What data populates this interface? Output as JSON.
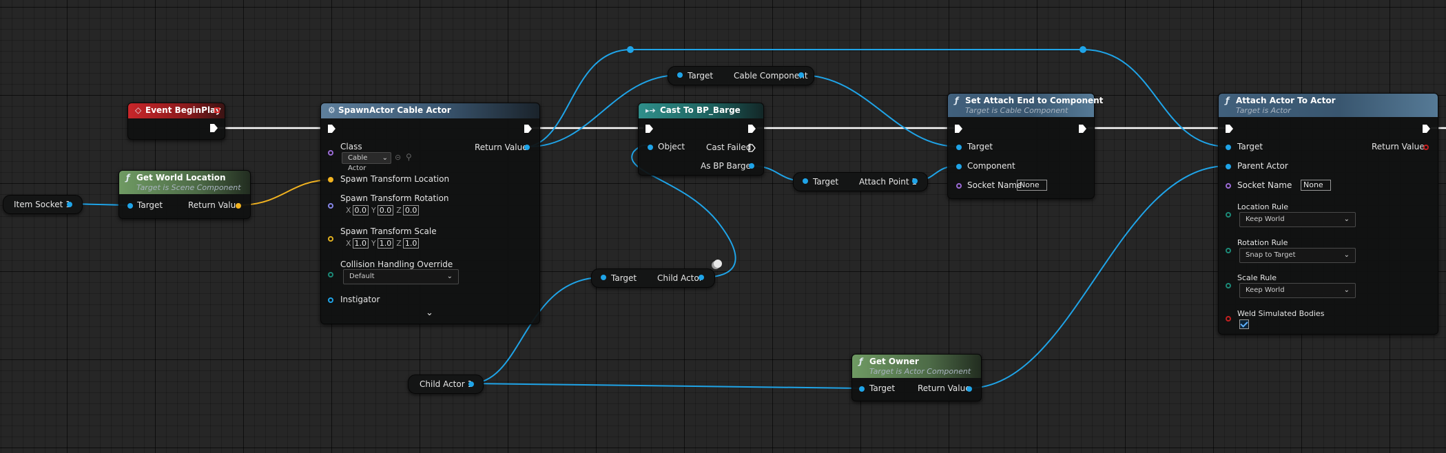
{
  "colors": {
    "object_wire": "#1fa4e8",
    "exec_wire": "#ffffff",
    "vector_wire": "#f2b320",
    "graph_bg": "#262626"
  },
  "nodes": {
    "event_begin_play": {
      "title": "Event BeginPlay",
      "icon": "event-diamond-icon"
    },
    "get_world_location": {
      "title": "Get World Location",
      "subtitle": "Target is Scene Component",
      "target": "Target",
      "return_value": "Return Value"
    },
    "spawn_actor": {
      "title": "SpawnActor Cable Actor",
      "class_label": "Class",
      "class_value": "Cable Actor",
      "return_value": "Return Value",
      "spawn_location": "Spawn Transform Location",
      "spawn_rotation": "Spawn Transform Rotation",
      "rotation": {
        "x": "0.0",
        "y": "0.0",
        "z": "0.0"
      },
      "spawn_scale": "Spawn Transform Scale",
      "scale": {
        "x": "1.0",
        "y": "1.0",
        "z": "1.0"
      },
      "axis_x": "X",
      "axis_y": "Y",
      "axis_z": "Z",
      "collision_label": "Collision Handling Override",
      "collision_value": "Default",
      "instigator": "Instigator"
    },
    "cast_to_barge": {
      "title": "Cast To BP_Barge",
      "object": "Object",
      "cast_failed": "Cast Failed",
      "as_bp_barge": "As BP Barge"
    },
    "set_attach_end": {
      "title": "Set Attach End to Component",
      "subtitle": "Target is Cable Component",
      "target": "Target",
      "component": "Component",
      "socket_name": "Socket Name",
      "socket_value": "None"
    },
    "attach_actor": {
      "title": "Attach Actor To Actor",
      "subtitle": "Target is Actor",
      "target": "Target",
      "return_value": "Return Value",
      "parent_actor": "Parent Actor",
      "socket_name": "Socket Name",
      "socket_value": "None",
      "location_rule": "Location Rule",
      "location_value": "Keep World",
      "rotation_rule": "Rotation Rule",
      "rotation_value": "Snap to Target",
      "scale_rule": "Scale Rule",
      "scale_value": "Keep World",
      "weld": "Weld Simulated Bodies"
    },
    "get_owner": {
      "title": "Get Owner",
      "subtitle": "Target is Actor Component",
      "target": "Target",
      "return_value": "Return Value"
    }
  },
  "getters": {
    "item_socket": "Item Socket 1",
    "cable_component": {
      "target": "Target",
      "value": "Cable Component"
    },
    "attach_point": {
      "target": "Target",
      "value": "Attach Point 1"
    },
    "child_actor": {
      "target": "Target",
      "value": "Child Actor"
    },
    "child_actor_var": "Child Actor 1"
  },
  "checkbox": {
    "weld_simulated_bodies": true
  }
}
